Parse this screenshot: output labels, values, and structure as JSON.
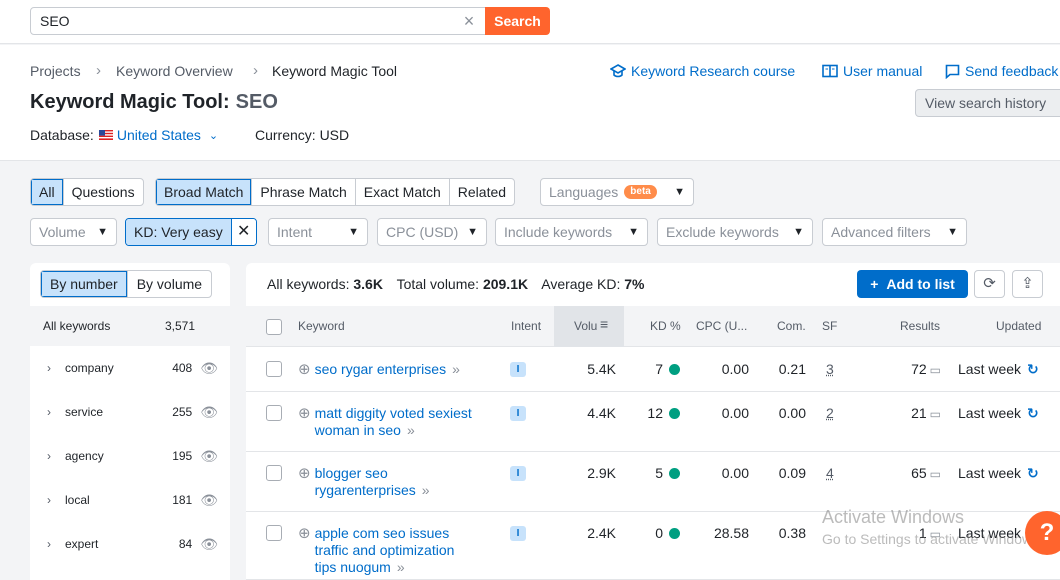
{
  "search": {
    "value": "SEO",
    "button": "Search"
  },
  "breadcrumb": [
    "Projects",
    "Keyword Overview",
    "Keyword Magic Tool"
  ],
  "header_links": {
    "course": "Keyword Research course",
    "manual": "User manual",
    "feedback": "Send feedback"
  },
  "title": {
    "main": "Keyword Magic Tool:",
    "query": "SEO"
  },
  "history_button": "View search history",
  "database": {
    "label": "Database:",
    "value": "United States"
  },
  "currency": "Currency: USD",
  "tabs_type": [
    "All",
    "Questions"
  ],
  "tabs_match": [
    "Broad Match",
    "Phrase Match",
    "Exact Match",
    "Related"
  ],
  "languages": {
    "label": "Languages",
    "badge": "beta"
  },
  "filters": {
    "volume": "Volume",
    "kd": "KD: Very easy",
    "intent": "Intent",
    "cpc": "CPC (USD)",
    "include": "Include keywords",
    "exclude": "Exclude keywords",
    "advanced": "Advanced filters"
  },
  "left": {
    "toggle": [
      "By number",
      "By volume"
    ],
    "all_label": "All keywords",
    "all_count": "3,571",
    "groups": [
      {
        "name": "company",
        "count": "408"
      },
      {
        "name": "service",
        "count": "255"
      },
      {
        "name": "agency",
        "count": "195"
      },
      {
        "name": "local",
        "count": "181"
      },
      {
        "name": "expert",
        "count": "84"
      }
    ]
  },
  "summary": {
    "all_label": "All keywords:",
    "all": "3.6K",
    "vol_label": "Total volume:",
    "vol": "209.1K",
    "kd_label": "Average KD:",
    "kd": "7%"
  },
  "add_to_list": "Add to list",
  "columns": {
    "keyword": "Keyword",
    "intent": "Intent",
    "volume": "Volu",
    "kd": "KD %",
    "cpc": "CPC (U...",
    "com": "Com.",
    "sf": "SF",
    "results": "Results",
    "updated": "Updated"
  },
  "rows": [
    {
      "kw1": "seo rygar enterprises",
      "kw2": "",
      "kw3": "",
      "intent": "I",
      "volume": "5.4K",
      "kd": "7",
      "cpc": "0.00",
      "com": "0.21",
      "sf": "3",
      "results": "72",
      "updated": "Last week"
    },
    {
      "kw1": "matt diggity voted sexiest",
      "kw2": "woman in seo",
      "kw3": "",
      "intent": "I",
      "volume": "4.4K",
      "kd": "12",
      "cpc": "0.00",
      "com": "0.00",
      "sf": "2",
      "results": "21",
      "updated": "Last week"
    },
    {
      "kw1": "blogger seo",
      "kw2": "rygarenterprises",
      "kw3": "",
      "intent": "I",
      "volume": "2.9K",
      "kd": "5",
      "cpc": "0.00",
      "com": "0.09",
      "sf": "4",
      "results": "65",
      "updated": "Last week"
    },
    {
      "kw1": "apple com seo issues",
      "kw2": "traffic and optimization",
      "kw3": "tips nuogum",
      "intent": "I",
      "volume": "2.4K",
      "kd": "0",
      "cpc": "28.58",
      "com": "0.38",
      "sf": "",
      "results": "1",
      "updated": "Last week"
    }
  ],
  "watermark": {
    "line1": "Activate Windows",
    "line2": "Go to Settings to activate Windows."
  },
  "help": "?"
}
